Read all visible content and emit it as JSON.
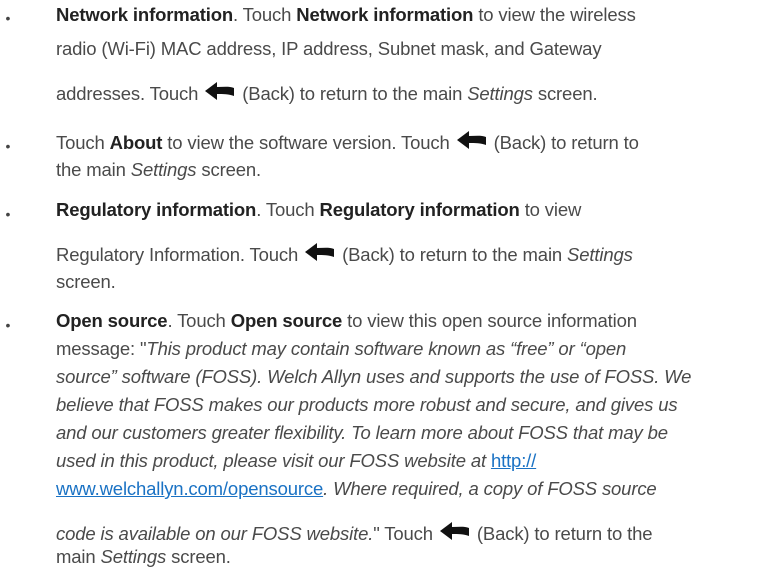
{
  "items": [
    {
      "lines": [
        [
          {
            "t": "Network information",
            "s": "b"
          },
          {
            "t": ". Touch "
          },
          {
            "t": "Network information",
            "s": "b"
          },
          {
            "t": " to view the wireless"
          }
        ],
        [
          {
            "t": "radio (Wi-Fi) MAC address, IP address, Subnet mask, and Gateway"
          }
        ],
        [
          {
            "t": "addresses. Touch "
          },
          {
            "icon": "back-arrow-icon"
          },
          {
            "t": " (Back) to return to the main "
          },
          {
            "t": "Settings",
            "s": "i"
          },
          {
            "t": " screen."
          }
        ]
      ]
    },
    {
      "lines": [
        [
          {
            "t": "Touch "
          },
          {
            "t": "About",
            "s": "b"
          },
          {
            "t": " to view the software version. Touch "
          },
          {
            "icon": "back-arrow-icon"
          },
          {
            "t": " (Back) to return to"
          }
        ],
        [
          {
            "t": "the main "
          },
          {
            "t": "Settings",
            "s": "i"
          },
          {
            "t": " screen."
          }
        ]
      ]
    },
    {
      "lines": [
        [
          {
            "t": "Regulatory information",
            "s": "b"
          },
          {
            "t": ". Touch "
          },
          {
            "t": "Regulatory information",
            "s": "b"
          },
          {
            "t": " to view"
          }
        ],
        [
          {
            "t": "Regulatory Information. Touch "
          },
          {
            "icon": "back-arrow-icon"
          },
          {
            "t": " (Back) to return to the main "
          },
          {
            "t": "Settings",
            "s": "i"
          }
        ],
        [
          {
            "t": "screen."
          }
        ]
      ]
    },
    {
      "lines": [
        [
          {
            "t": "Open source",
            "s": "b"
          },
          {
            "t": ". Touch "
          },
          {
            "t": "Open source",
            "s": "b"
          },
          {
            "t": " to view this open source information"
          }
        ],
        [
          {
            "t": "message: \""
          },
          {
            "t": "This product may contain software known as “free” or “open",
            "s": "i"
          }
        ],
        [
          {
            "t": "source” software (FOSS). Welch Allyn uses and supports the use of FOSS. We",
            "s": "i"
          }
        ],
        [
          {
            "t": "believe that FOSS makes our products more robust and secure, and gives us",
            "s": "i"
          }
        ],
        [
          {
            "t": "and our customers greater flexibility. To learn more about FOSS that may be",
            "s": "i"
          }
        ],
        [
          {
            "t": "used in this product, please visit our FOSS website at ",
            "s": "i"
          },
          {
            "t": "http://",
            "s": "link"
          }
        ],
        [
          {
            "t": "www.welchallyn.com/opensource",
            "s": "link"
          },
          {
            "t": ". Where required, a copy of FOSS source",
            "s": "i"
          }
        ],
        [
          {
            "t": "code is available on our FOSS website.",
            "s": "i"
          },
          {
            "t": "\" Touch "
          },
          {
            "icon": "back-arrow-icon"
          },
          {
            "t": " (Back) to return to the"
          }
        ],
        [
          {
            "t": "main "
          },
          {
            "t": "Settings",
            "s": "i"
          },
          {
            "t": " screen."
          }
        ]
      ]
    }
  ],
  "bullet_char": "•"
}
